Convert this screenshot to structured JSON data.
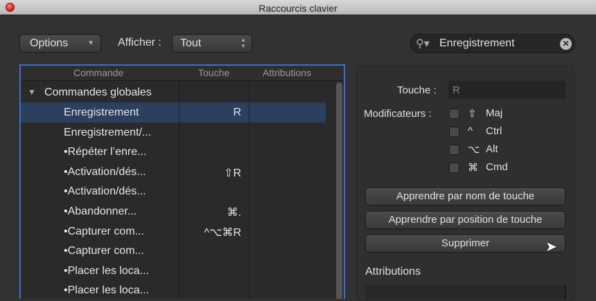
{
  "window": {
    "title": "Raccourcis clavier"
  },
  "toolbar": {
    "options_label": "Options",
    "afficher_label": "Afficher :",
    "afficher_value": "Tout"
  },
  "search": {
    "value": "Enregistrement"
  },
  "table": {
    "headers": [
      "Commande",
      "Touche",
      "Attributions"
    ],
    "group": "Commandes globales",
    "rows": [
      {
        "command": "Enregistrement",
        "key": "R"
      },
      {
        "command": "Enregistrement/...",
        "key": ""
      },
      {
        "command": "•Répéter l’enre...",
        "key": ""
      },
      {
        "command": "•Activation/dés...",
        "key": "⇧R"
      },
      {
        "command": "•Activation/dés...",
        "key": ""
      },
      {
        "command": "•Abandonner...",
        "key": "⌘."
      },
      {
        "command": "•Capturer com...",
        "key": "^⌥⌘R"
      },
      {
        "command": "•Capturer com...",
        "key": ""
      },
      {
        "command": "•Placer les loca...",
        "key": ""
      },
      {
        "command": "•Placer les loca...",
        "key": ""
      }
    ]
  },
  "inspector": {
    "touche_label": "Touche :",
    "touche_value": "R",
    "modifiers_label": "Modificateurs :",
    "modifiers": [
      {
        "symbol": "⇧",
        "label": "Maj"
      },
      {
        "symbol": "^",
        "label": "Ctrl"
      },
      {
        "symbol": "⌥",
        "label": "Alt"
      },
      {
        "symbol": "⌘",
        "label": "Cmd"
      }
    ],
    "learn_name": "Apprendre par nom de touche",
    "learn_position": "Apprendre par position de touche",
    "delete": "Supprimer",
    "attributions_label": "Attributions"
  }
}
